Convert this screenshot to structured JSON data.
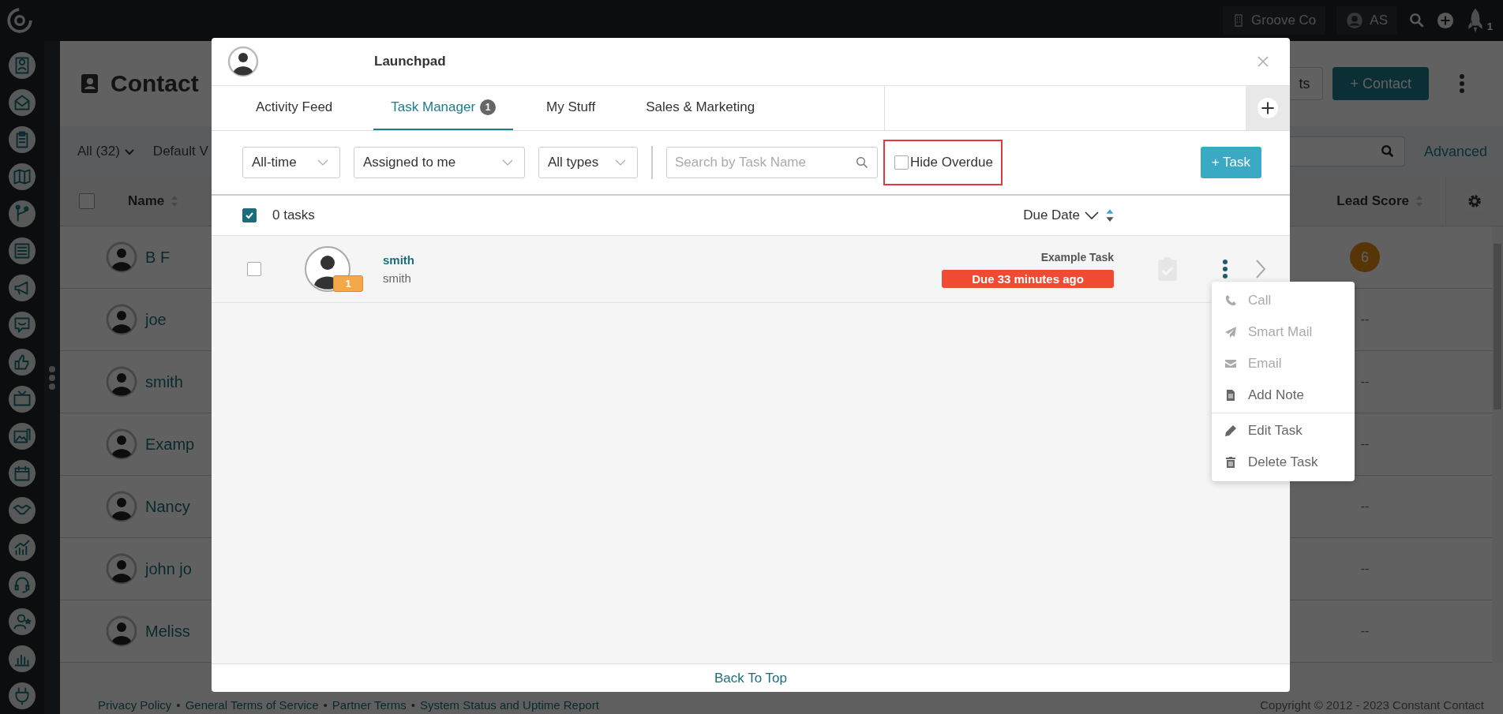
{
  "topbar": {
    "account": "Groove Co",
    "user_initials": "AS",
    "notification_count": "1"
  },
  "page": {
    "title": "Contact",
    "secondary_button": "ts",
    "primary_button": "+ Contact",
    "filter": {
      "view": "All (32)",
      "saved_view": "Default V",
      "advanced": "Advanced"
    },
    "table": {
      "select_all_checked": false,
      "columns": [
        "Name",
        "Lead Score"
      ],
      "rows": [
        {
          "name": "B F",
          "lead_score": "6",
          "scored": true
        },
        {
          "name": "joe",
          "lead_score": "--",
          "scored": false
        },
        {
          "name": "smith",
          "lead_score": "--",
          "scored": false
        },
        {
          "name": "Examp",
          "lead_score": "--",
          "scored": false
        },
        {
          "name": "Nancy",
          "lead_score": "--",
          "scored": false
        },
        {
          "name": "john jo",
          "lead_score": "--",
          "scored": false
        },
        {
          "name": "Meliss",
          "lead_score": "--",
          "scored": false
        }
      ]
    },
    "footer": {
      "separator": "•",
      "links": [
        "Privacy Policy",
        "General Terms of Service",
        "Partner Terms",
        "System Status and Uptime Report"
      ],
      "copyright": "Copyright © 2012 - 2023 Constant Contact"
    }
  },
  "launchpad": {
    "title": "Launchpad",
    "tabs": [
      {
        "label": "Activity Feed",
        "selected": false
      },
      {
        "label": "Task Manager",
        "badge": "1",
        "selected": true
      },
      {
        "label": "My Stuff",
        "selected": false
      },
      {
        "label": "Sales & Marketing",
        "selected": false
      }
    ],
    "filters": {
      "selects": [
        "All-time",
        "Assigned to me",
        "All types"
      ],
      "search": {
        "placeholder": "Search by Task Name"
      },
      "hide_overdue": {
        "label": "Hide Overdue",
        "checked": false,
        "highlighted": true
      },
      "add_button": "+ Task"
    },
    "list": {
      "select_all_checked": true,
      "count": "0 tasks",
      "sort_label": "Due Date"
    },
    "tasks": [
      {
        "contact": "smith",
        "subtitle": "smith",
        "badge": "1",
        "title": "Example Task",
        "due": "Due 33 minutes ago",
        "overdue": true,
        "checked": false
      }
    ],
    "menu": {
      "groups": [
        [
          {
            "label": "Call",
            "kind": "phone",
            "disabled": true
          },
          {
            "label": "Smart Mail",
            "kind": "send",
            "disabled": true
          },
          {
            "label": "Email",
            "kind": "envelope",
            "disabled": true
          },
          {
            "label": "Add Note",
            "kind": "note",
            "disabled": false
          }
        ],
        [
          {
            "label": "Edit Task",
            "kind": "pencil",
            "disabled": false
          },
          {
            "label": "Delete Task",
            "kind": "trash",
            "disabled": false
          }
        ]
      ]
    },
    "back_to_top": "Back To Top"
  }
}
